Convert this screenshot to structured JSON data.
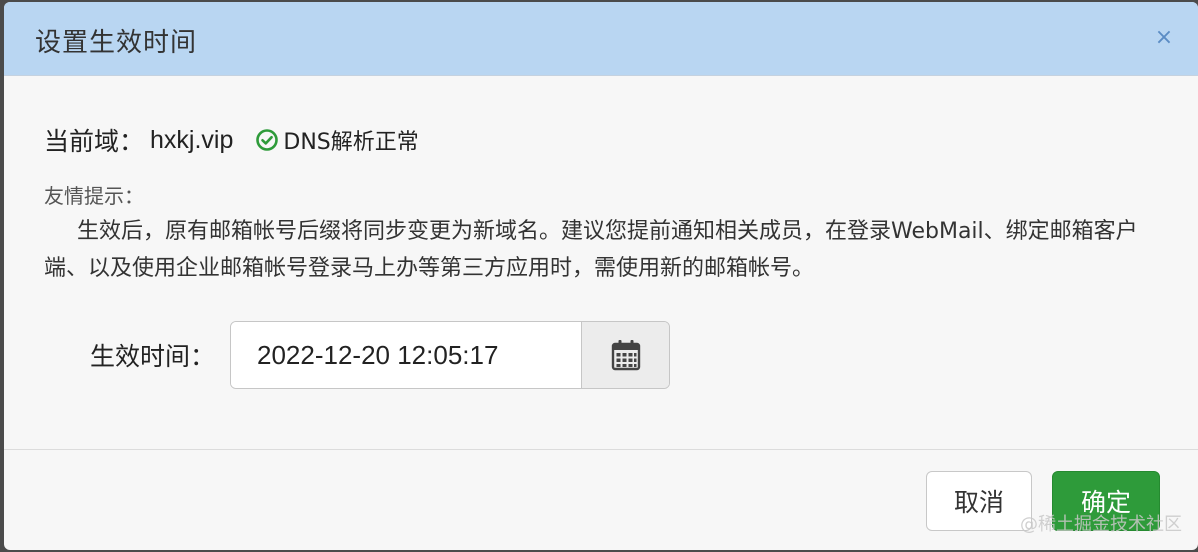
{
  "dialog": {
    "title": "设置生效时间",
    "close_glyph": "×"
  },
  "domain": {
    "label": "当前域：",
    "value": "hxkj.vip",
    "status_icon": "check-circle-icon",
    "status_text": "DNS解析正常",
    "status_color": "#2e9b3a"
  },
  "tip": {
    "title": "友情提示：",
    "body": "生效后，原有邮箱帐号后缀将同步变更为新域名。建议您提前通知相关成员，在登录WebMail、绑定邮箱客户端、以及使用企业邮箱帐号登录马上办等第三方应用时，需使用新的邮箱帐号。"
  },
  "effective_time": {
    "label": "生效时间：",
    "value": "2022-12-20 12:05:17",
    "calendar_icon": "calendar-icon"
  },
  "buttons": {
    "cancel": "取消",
    "ok": "确定"
  },
  "colors": {
    "header_bg": "#b9d6f2",
    "primary_button": "#2e9b3a"
  },
  "watermark": "@稀土掘金技术社区"
}
